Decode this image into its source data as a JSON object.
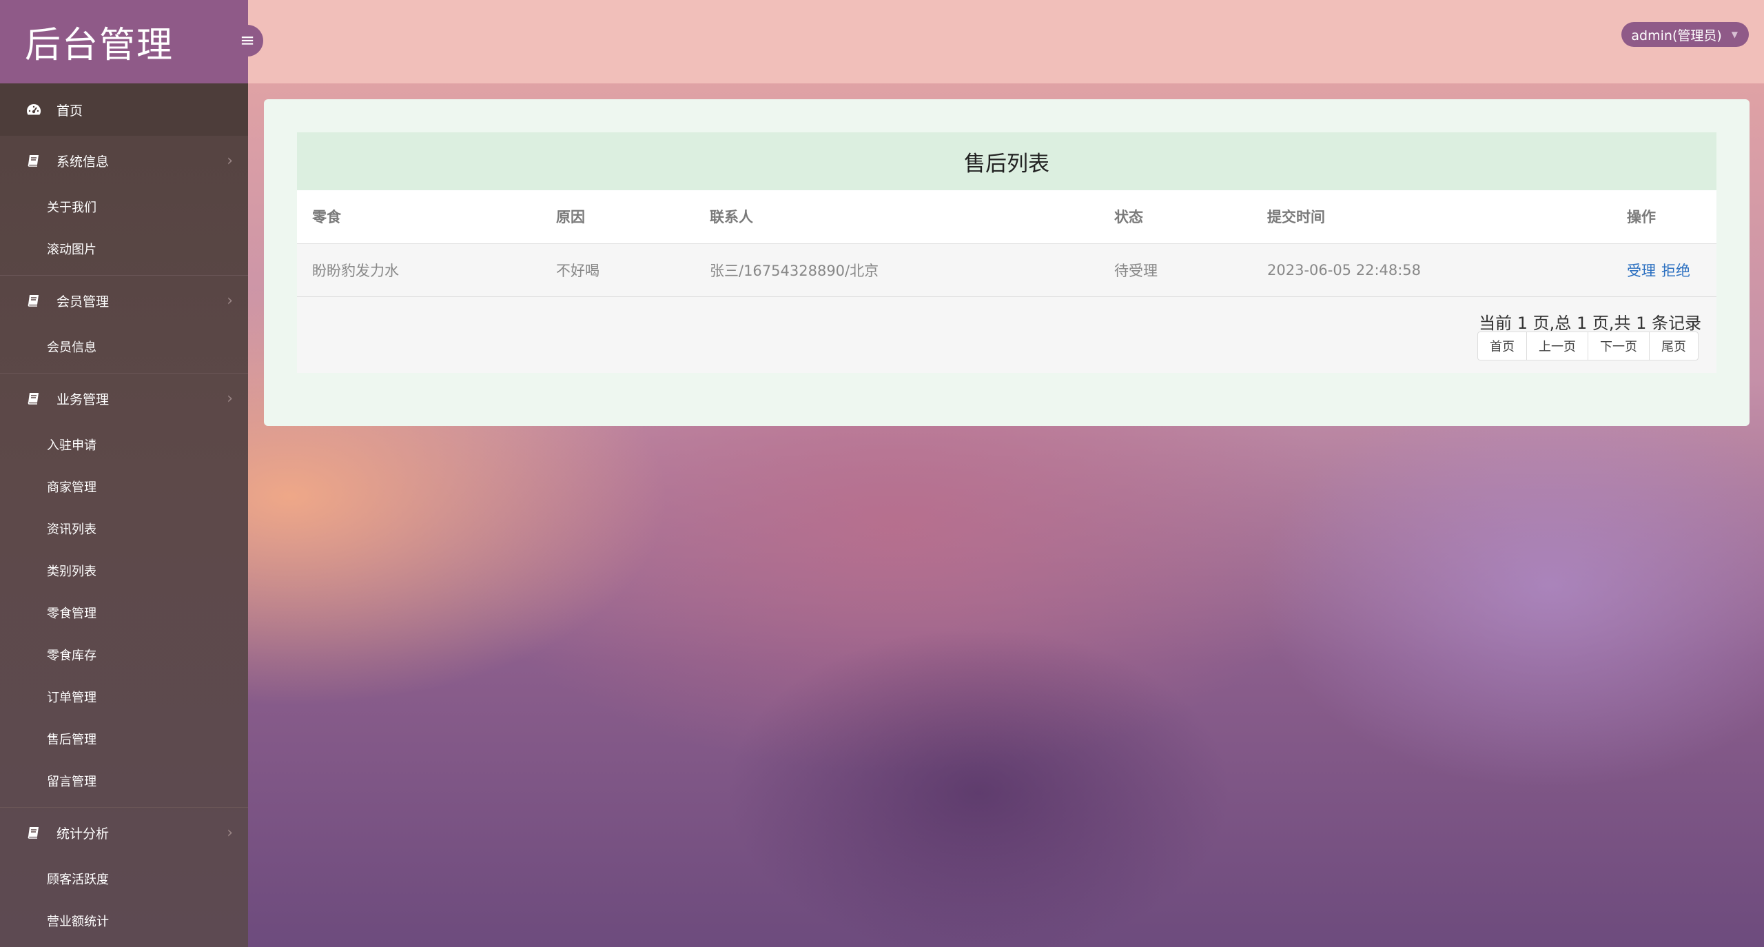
{
  "brand": {
    "title": "后台管理"
  },
  "header": {
    "user_label": "admin(管理员)"
  },
  "sidebar": {
    "home": "首页",
    "groups": [
      {
        "label": "系统信息",
        "items": [
          "关于我们",
          "滚动图片"
        ]
      },
      {
        "label": "会员管理",
        "items": [
          "会员信息"
        ]
      },
      {
        "label": "业务管理",
        "items": [
          "入驻申请",
          "商家管理",
          "资讯列表",
          "类别列表",
          "零食管理",
          "零食库存",
          "订单管理",
          "售后管理",
          "留言管理"
        ]
      },
      {
        "label": "统计分析",
        "items": [
          "顾客活跃度",
          "营业额统计"
        ]
      }
    ]
  },
  "panel": {
    "title": "售后列表",
    "columns": [
      "零食",
      "原因",
      "联系人",
      "状态",
      "提交时间",
      "操作"
    ],
    "rows": [
      {
        "snack": "盼盼豹发力水",
        "reason": "不好喝",
        "contact": "张三/16754328890/北京",
        "status": "待受理",
        "time": "2023-06-05 22:48:58",
        "accept": "受理",
        "reject": "拒绝"
      }
    ]
  },
  "pager": {
    "info": "当前 1 页,总 1 页,共 1 条记录",
    "first": "首页",
    "prev": "上一页",
    "next": "下一页",
    "last": "尾页"
  },
  "colors": {
    "brand": "#8f5a88",
    "sidebar": "#5b4647",
    "header": "#f1bfba",
    "link": "#2a6fc0"
  }
}
